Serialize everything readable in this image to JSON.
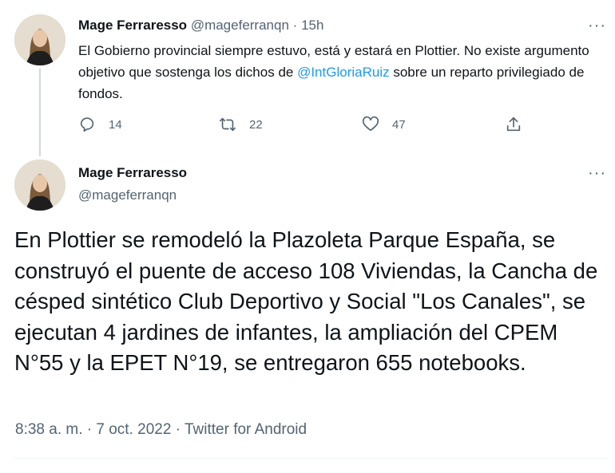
{
  "reply_tweet": {
    "author_name": "Mage Ferraresso",
    "author_handle": "@mageferranqn",
    "separator": "·",
    "time": "15h",
    "text_before": "El Gobierno provincial siempre estuvo, está y estará en Plottier. No existe argumento objetivo que sostenga los dichos de ",
    "mention": "@IntGloriaRuiz",
    "text_after": " sobre un reparto privilegiado de fondos.",
    "replies": "14",
    "retweets": "22",
    "likes": "47",
    "more_label": "···"
  },
  "main_tweet": {
    "author_name": "Mage Ferraresso",
    "author_handle": "@mageferranqn",
    "text": "En Plottier se remodeló la Plazoleta Parque España, se construyó el puente de acceso 108 Viviendas, la Cancha de césped sintético Club Deportivo y Social \"Los Canales\", se ejecutan 4 jardines de infantes, la ampliación del CPEM N°55 y la EPET N°19, se entregaron 655 notebooks.",
    "time": "8:38 a. m.",
    "separator": "·",
    "date": "7 oct. 2022",
    "client": "Twitter for Android",
    "more_label": "···"
  },
  "colors": {
    "link": "#1d9bf0",
    "secondary_text": "#536471",
    "primary_text": "#0f1419"
  },
  "icons": [
    "reply-icon",
    "retweet-icon",
    "like-icon",
    "share-icon",
    "more-icon"
  ]
}
